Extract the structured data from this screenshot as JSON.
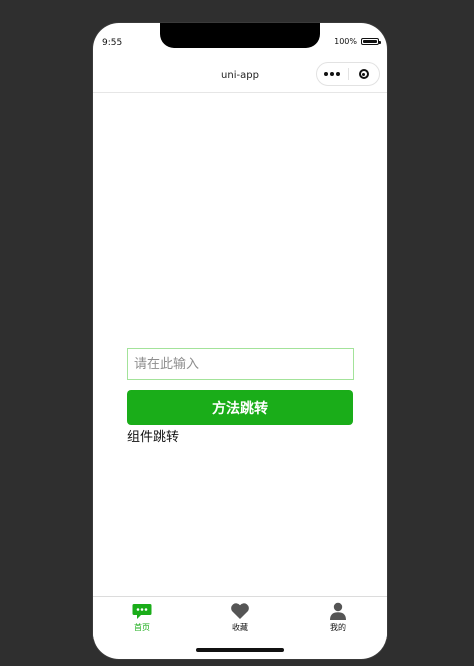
{
  "status_bar": {
    "time": "9:55",
    "battery": "100%"
  },
  "navbar": {
    "title": "uni-app"
  },
  "form": {
    "input_placeholder": "请在此输入",
    "method_button": "方法跳转",
    "component_link": "组件跳转"
  },
  "tabbar": {
    "items": [
      {
        "label": "首页",
        "icon": "chat-bubble-icon",
        "active": true
      },
      {
        "label": "收藏",
        "icon": "heart-icon",
        "active": false
      },
      {
        "label": "我的",
        "icon": "person-icon",
        "active": false
      }
    ]
  },
  "colors": {
    "accent": "#1aad19",
    "input_border": "#a3e39a",
    "backdrop": "#2f2f2f"
  }
}
